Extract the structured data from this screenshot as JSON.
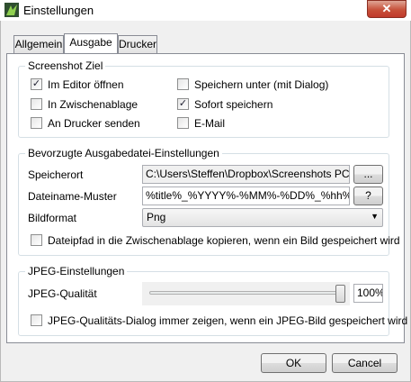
{
  "window": {
    "title": "Einstellungen",
    "close_glyph": "✕",
    "icon": "app-icon"
  },
  "tabs": [
    {
      "label": "Allgemein",
      "active": false
    },
    {
      "label": "Ausgabe",
      "active": true
    },
    {
      "label": "Drucker",
      "active": false
    }
  ],
  "screenshot_ziel": {
    "title": "Screenshot Ziel",
    "options": [
      {
        "label": "Im Editor öffnen",
        "checked": true
      },
      {
        "label": "In Zwischenablage",
        "checked": false
      },
      {
        "label": "An Drucker senden",
        "checked": false
      },
      {
        "label": "Speichern unter (mit Dialog)",
        "checked": false
      },
      {
        "label": "Sofort speichern",
        "checked": true
      },
      {
        "label": "E-Mail",
        "checked": false
      }
    ]
  },
  "ausgabe": {
    "title": "Bevorzugte Ausgabedatei-Einstellungen",
    "speicherort_label": "Speicherort",
    "speicherort_value": "C:\\Users\\Steffen\\Dropbox\\Screenshots PC",
    "browse_label": "...",
    "dateiname_label": "Dateiname-Muster",
    "dateiname_value": "%title%_%YYYY%-%MM%-%DD%_%hh%-%mm%-",
    "help_label": "?",
    "bildformat_label": "Bildformat",
    "bildformat_value": "Png",
    "copy_path_label": "Dateipfad in die Zwischenablage kopieren, wenn ein Bild gespeichert wird",
    "copy_path_checked": false
  },
  "jpeg": {
    "title": "JPEG-Einstellungen",
    "quality_label": "JPEG-Qualität",
    "quality_value": "100%",
    "quality_fraction": 1.0,
    "dialog_label": "JPEG-Qualitäts-Dialog immer zeigen, wenn ein JPEG-Bild gespeichert wird",
    "dialog_checked": false
  },
  "buttons": {
    "ok": "OK",
    "cancel": "Cancel"
  },
  "check_glyph": "✓",
  "dropdown_glyph": "▼"
}
